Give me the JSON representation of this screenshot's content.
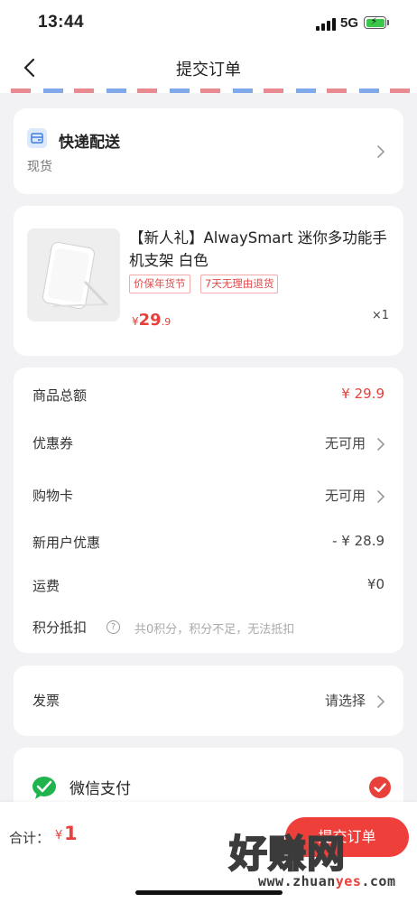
{
  "status_bar": {
    "time": "13:44",
    "network": "5G"
  },
  "nav": {
    "title": "提交订单"
  },
  "delivery": {
    "title": "快递配送",
    "subtitle": "现货"
  },
  "product": {
    "title": "【新人礼】AlwaySmart 迷你多功能手机支架 白色",
    "tags": [
      "价保年货节",
      "7天无理由退货"
    ],
    "price_symbol": "¥",
    "price_int": "29",
    "price_dec": ".9",
    "quantity": "×1"
  },
  "summary": {
    "goods_total_label": "商品总额",
    "goods_total_value": "¥ 29.9",
    "coupon_label": "优惠券",
    "coupon_value": "无可用",
    "shopping_card_label": "购物卡",
    "shopping_card_value": "无可用",
    "new_user_label": "新用户优惠",
    "new_user_value": "- ¥ 28.9",
    "shipping_label": "运费",
    "shipping_value": "¥0",
    "points_label": "积分抵扣",
    "points_help": "?",
    "points_note": "共0积分，积分不足，无法抵扣"
  },
  "invoice": {
    "label": "发票",
    "value": "请选择"
  },
  "payment": {
    "label": "微信支付"
  },
  "bottom": {
    "total_label": "合计：",
    "total_symbol": "¥",
    "total_value": "1",
    "submit_label": "提交订单"
  },
  "watermark": {
    "text": "好赚网",
    "url_prefix": "www.zhuan",
    "url_highlight": "yes",
    "url_suffix": ".com"
  },
  "colors": {
    "accent": "#e8403b",
    "wechat_green": "#21b34e",
    "background": "#f2f2f4"
  },
  "icons": {
    "back": "chevron-left-icon",
    "delivery": "truck-icon",
    "chevron": "chevron-right-icon",
    "wechat": "wechat-pay-icon",
    "check": "check-circle-icon"
  }
}
